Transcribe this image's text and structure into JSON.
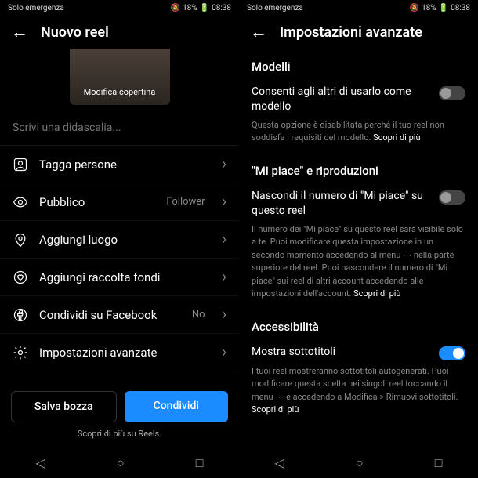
{
  "status": {
    "left": "Solo emergenza",
    "battery": "18%",
    "time": "08:38"
  },
  "left": {
    "title": "Nuovo reel",
    "cover_btn": "Modifica copertina",
    "caption_placeholder": "Scrivi una didascalia...",
    "rows": [
      {
        "label": "Tagga persone",
        "val": ""
      },
      {
        "label": "Pubblico",
        "val": "Follower"
      },
      {
        "label": "Aggiungi luogo",
        "val": ""
      },
      {
        "label": "Aggiungi raccolta fondi",
        "val": ""
      },
      {
        "label": "Condividi su Facebook",
        "val": "No"
      },
      {
        "label": "Impostazioni avanzate",
        "val": ""
      }
    ],
    "draft": "Salva bozza",
    "share": "Condividi",
    "more": "Scopri di più su Reels."
  },
  "right": {
    "title": "Impostazioni avanzate",
    "s1": "Modelli",
    "t1": "Consenti agli altri di usarlo come modello",
    "d1a": "Questa opzione è disabilitata perché il tuo reel non soddisfa i requisiti del modello. ",
    "d1b": "Scopri di più",
    "s2": "\"Mi piace\" e riproduzioni",
    "t2": "Nascondi il numero di \"Mi piace\" su questo reel",
    "d2a": "Il numero dei \"Mi piace\" su questo reel sarà visibile solo a te. Puoi modificare questa impostazione in un secondo momento accedendo al menu ⋯ nella parte superiore del reel. Puoi nascondere il numero di \"Mi piace\" sui reel di altri account accedendo alle impostazioni dell'account. ",
    "d2b": "Scopri di più",
    "s3": "Accessibilità",
    "t3": "Mostra sottotitoli",
    "d3a": "I tuoi reel mostreranno sottotitoli autogenerati. Puoi modificare questa scelta nei singoli reel toccando il menu ⋯ e accedendo a Modifica > Rimuovi sottotitoli. ",
    "d3b": "Scopri di più"
  }
}
